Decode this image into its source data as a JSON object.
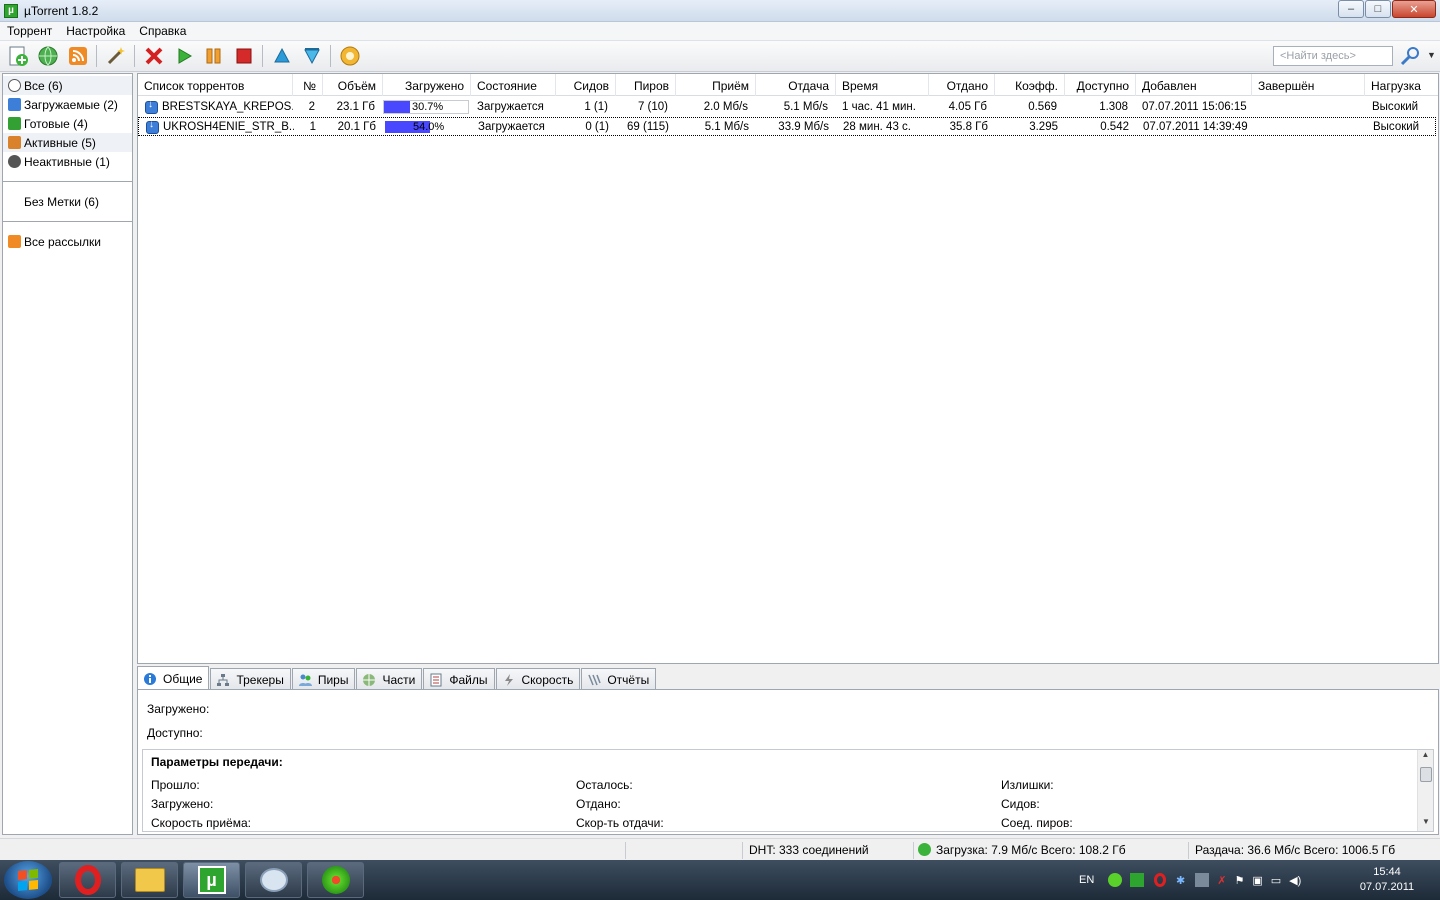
{
  "window": {
    "title": "µTorrent 1.8.2",
    "app_icon_letter": "µ",
    "buttons": {
      "minimize": "–",
      "maximize": "□",
      "close": "✕"
    }
  },
  "menu": [
    "Торрент",
    "Настройка",
    "Справка"
  ],
  "search": {
    "placeholder": "<Найти здесь>"
  },
  "sidebar": {
    "categories": [
      {
        "label": "Все (6)",
        "icon": "all-icon",
        "color": "#555555"
      },
      {
        "label": "Загружаемые (2)",
        "icon": "download-icon",
        "color": "#3d7fd8"
      },
      {
        "label": "Готовые (4)",
        "icon": "seed-icon",
        "color": "#33a033"
      },
      {
        "label": "Активные (5)",
        "icon": "active-icon",
        "color": "#d9822b"
      },
      {
        "label": "Неактивные (1)",
        "icon": "inactive-icon",
        "color": "#555555"
      }
    ],
    "labels": [
      {
        "label": "Без Метки (6)"
      }
    ],
    "feeds": [
      {
        "label": "Все рассылки",
        "icon": "rss-icon",
        "color": "#f08a24"
      }
    ]
  },
  "columns": [
    "Список торрентов",
    "№",
    "Объём",
    "Загружено",
    "Состояние",
    "Сидов",
    "Пиров",
    "Приём",
    "Отдача",
    "Время",
    "Отдано",
    "Коэфф.",
    "Доступно",
    "Добавлен",
    "Завершён",
    "Нагрузка"
  ],
  "torrents": [
    {
      "name": "BRESTSKAYA_KREPOS...",
      "num": "2",
      "size": "23.1 Гб",
      "progress_text": "30.7%",
      "progress": 0.307,
      "status": "Загружается",
      "seeds": "1 (1)",
      "peers": "7 (10)",
      "down": "2.0 Мб/s",
      "up": "5.1 Мб/s",
      "eta": "1 час. 41 мин.",
      "uploaded": "4.05 Гб",
      "ratio": "0.569",
      "avail": "1.308",
      "added": "07.07.2011 15:06:15",
      "completed": "",
      "priority": "Высокий"
    },
    {
      "name": "UKROSH4ENIE_STR_B...",
      "num": "1",
      "size": "20.1 Гб",
      "progress_text": "54.0%",
      "progress": 0.54,
      "status": "Загружается",
      "seeds": "0 (1)",
      "peers": "69 (115)",
      "down": "5.1 Мб/s",
      "up": "33.9 Мб/s",
      "eta": "28 мин. 43 с.",
      "uploaded": "35.8 Гб",
      "ratio": "3.295",
      "avail": "0.542",
      "added": "07.07.2011 14:39:49",
      "completed": "",
      "priority": "Высокий"
    }
  ],
  "tabs": [
    "Общие",
    "Трекеры",
    "Пиры",
    "Части",
    "Файлы",
    "Скорость",
    "Отчёты"
  ],
  "general": {
    "downloaded_label": "Загружено:",
    "available_label": "Доступно:",
    "params_title": "Параметры передачи:",
    "col1": [
      "Прошло:",
      "Загружено:",
      "Скорость приёма:"
    ],
    "col2": [
      "Осталось:",
      "Отдано:",
      "Скор-ть отдачи:"
    ],
    "col3": [
      "Излишки:",
      "Сидов:",
      "Соед. пиров:"
    ]
  },
  "statusbar": {
    "dht": "DHT: 333 соединений",
    "download": "Загрузка: 7.9 Мб/с Всего: 108.2 Гб",
    "upload": "Раздача: 36.6 Мб/с Всего: 1006.5 Гб"
  },
  "taskbar": {
    "language": "EN",
    "time": "15:44",
    "date": "07.07.2011",
    "apps": [
      "opera-icon",
      "explorer-icon",
      "utorrent-icon",
      "paint-icon",
      "icq-icon"
    ]
  }
}
